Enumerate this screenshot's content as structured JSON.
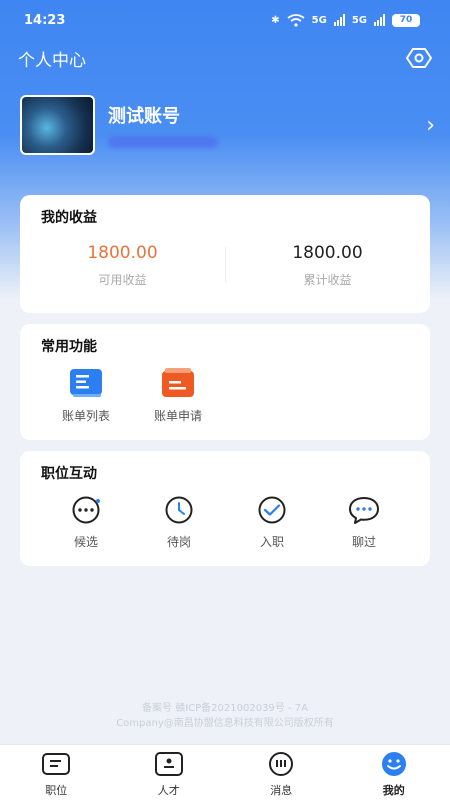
{
  "status": {
    "time": "14:23",
    "battery": "70",
    "network": "5G"
  },
  "header": {
    "title": "个人中心",
    "settings_icon": "eye-settings-icon"
  },
  "profile": {
    "name": "测试账号"
  },
  "earnings": {
    "title": "我的收益",
    "available_value": "1800.00",
    "available_label": "可用收益",
    "total_value": "1800.00",
    "total_label": "累计收益"
  },
  "common": {
    "title": "常用功能",
    "items": [
      {
        "label": "账单列表",
        "icon": "bill-list-icon"
      },
      {
        "label": "账单申请",
        "icon": "bill-apply-icon"
      }
    ]
  },
  "job": {
    "title": "职位互动",
    "items": [
      {
        "label": "候选",
        "icon": "candidate-icon"
      },
      {
        "label": "待岗",
        "icon": "clock-icon"
      },
      {
        "label": "入职",
        "icon": "check-icon"
      },
      {
        "label": "聊过",
        "icon": "chat-icon"
      }
    ]
  },
  "footer": {
    "line1": "备案号 赣ICP备2021002039号 - 7A",
    "line2": "Company@南昌协盟信息科技有限公司版权所有"
  },
  "tabs": [
    {
      "label": "职位",
      "icon": "position-icon"
    },
    {
      "label": "人才",
      "icon": "talent-icon"
    },
    {
      "label": "消息",
      "icon": "message-icon"
    },
    {
      "label": "我的",
      "icon": "mine-icon",
      "active": true
    }
  ],
  "colors": {
    "primary": "#3f86f2",
    "accent_orange": "#e8743b"
  }
}
